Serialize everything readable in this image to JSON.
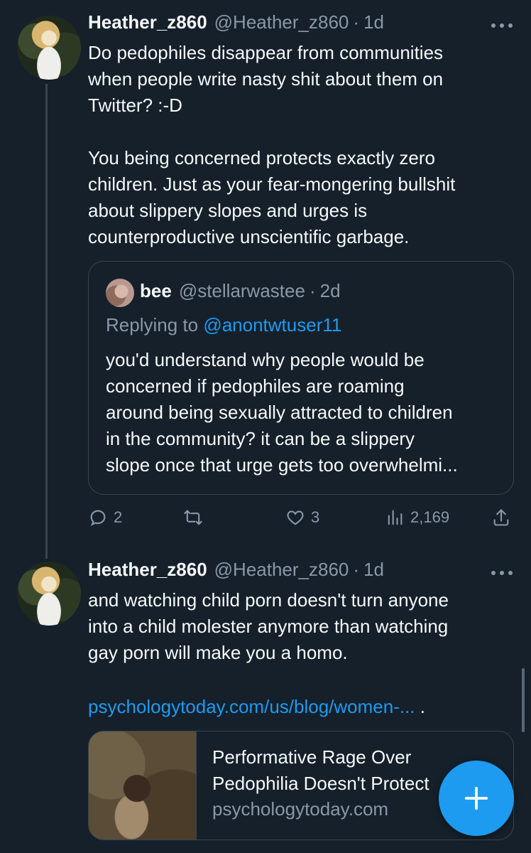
{
  "tweets": [
    {
      "name": "Heather_z860",
      "handle": "@Heather_z860",
      "separator": "·",
      "time": "1d",
      "text_lines": [
        "Do pedophiles disappear from communities",
        "when people write nasty shit about them on",
        "Twitter? :-D",
        "",
        "You being concerned protects exactly zero",
        "children. Just as your fear-mongering bullshit",
        "about slippery slopes and urges is",
        "counterproductive unscientific garbage."
      ],
      "quote": {
        "name": "bee",
        "handle": "@stellarwastee",
        "separator": "·",
        "time": "2d",
        "replying_prefix": "Replying to ",
        "replying_to": "@anontwtuser11",
        "text_lines": [
          "you'd understand why people would be",
          "concerned if pedophiles are roaming",
          "around being sexually attracted to children",
          "in the community? it can be a slippery",
          "slope once that urge gets too overwhelmi..."
        ]
      },
      "actions": {
        "reply_icon": "reply-icon",
        "reply_count": "2",
        "retweet_icon": "retweet-icon",
        "like_icon": "like-icon",
        "like_count": "3",
        "views_icon": "views-icon",
        "views_count": "2,169",
        "share_icon": "share-icon"
      }
    },
    {
      "name": "Heather_z860",
      "handle": "@Heather_z860",
      "separator": "·",
      "time": "1d",
      "text_lines": [
        "and watching child porn doesn't turn anyone",
        "into a child molester anymore than watching",
        "gay porn will make you a homo."
      ],
      "link": "psychologytoday.com/us/blog/women-...",
      "link_suffix": " .",
      "card": {
        "title": "Performative Rage Over Pedophilia Doesn't Protect",
        "domain": "psychologytoday.com"
      }
    }
  ],
  "fab": {
    "icon": "compose-plus-icon"
  },
  "colors": {
    "background": "#15202b",
    "accent": "#1d9bf0",
    "muted": "#8b98a5",
    "border": "#38444d"
  }
}
